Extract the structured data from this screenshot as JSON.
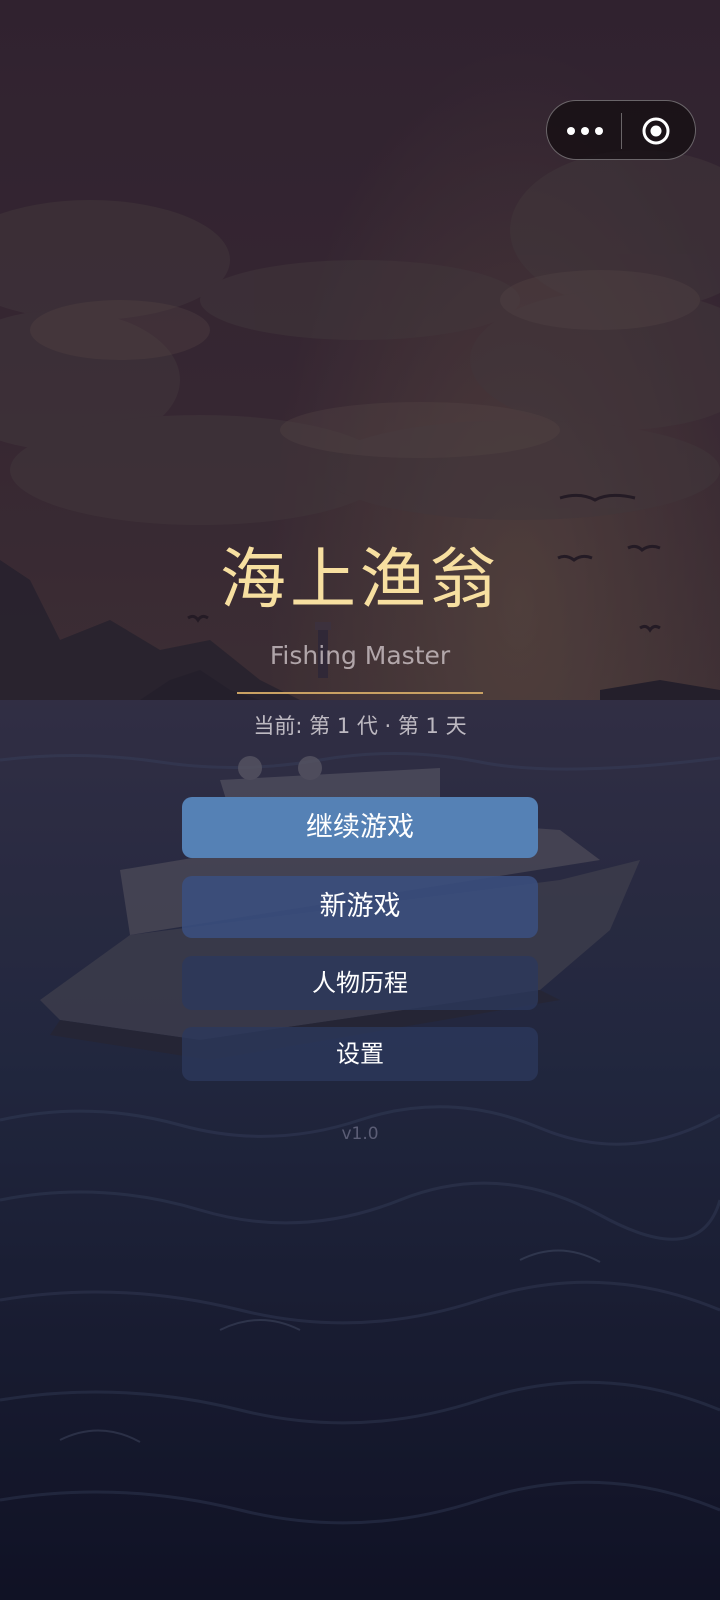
{
  "capsule": {
    "more_icon": "more-dots-icon",
    "close_icon": "target-circle-icon"
  },
  "title": {
    "main": "海上渔翁",
    "sub": "Fishing Master",
    "progress": "当前: 第 1 代 · 第 1 天"
  },
  "menu": {
    "continue_label": "继续游戏",
    "new_label": "新游戏",
    "history_label": "人物历程",
    "settings_label": "设置"
  },
  "version": "v1.0",
  "colors": {
    "title": "#f7dfa0",
    "accent_button": "#5581b5",
    "divider": "#c9a163"
  }
}
